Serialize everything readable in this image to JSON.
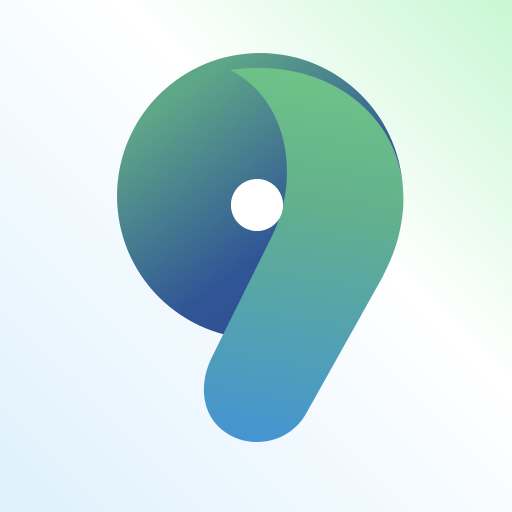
{
  "app_icon": {
    "logo_name": "nine-shaped-logo",
    "colors": {
      "background_top_right": "#c8f7d3",
      "background_mid": "#ffffff",
      "background_bottom_left": "#def1fc",
      "bowl_light_green": "#5ea688",
      "bowl_dark_blue": "#305596",
      "tail_top_green": "#6ec387",
      "tail_bottom_blue": "#4594d2",
      "hole": "#ffffff"
    }
  }
}
